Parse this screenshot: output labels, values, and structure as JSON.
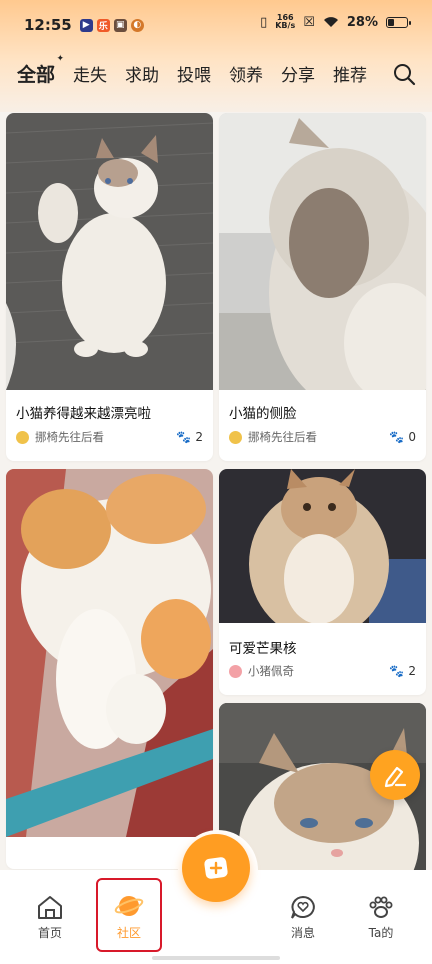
{
  "status_bar": {
    "time": "12:55",
    "net_speed_value": "166",
    "net_speed_unit": "KB/s",
    "battery": "28%"
  },
  "tabs": [
    {
      "label": "全部",
      "active": true
    },
    {
      "label": "走失"
    },
    {
      "label": "求助"
    },
    {
      "label": "投喂"
    },
    {
      "label": "领养"
    },
    {
      "label": "分享"
    },
    {
      "label": "推荐"
    }
  ],
  "posts": [
    {
      "title": "小猫养得越来越漂亮啦",
      "author": "挪椅先往后看",
      "likes": "2"
    },
    {
      "title": "小猫的侧脸",
      "author": "挪椅先往后看",
      "likes": "0"
    },
    {
      "title": "",
      "author": "",
      "likes": ""
    },
    {
      "title": "可爱芒果核",
      "author": "小猪佩奇",
      "likes": "2"
    },
    {
      "title": "",
      "author": "",
      "likes": ""
    }
  ],
  "nav": [
    {
      "label": "首页"
    },
    {
      "label": "社区",
      "active": true
    },
    {
      "label": "消息"
    },
    {
      "label": "Ta的"
    }
  ],
  "colors": {
    "accent": "#ff9a2e",
    "highlight_box": "#d8192a"
  }
}
